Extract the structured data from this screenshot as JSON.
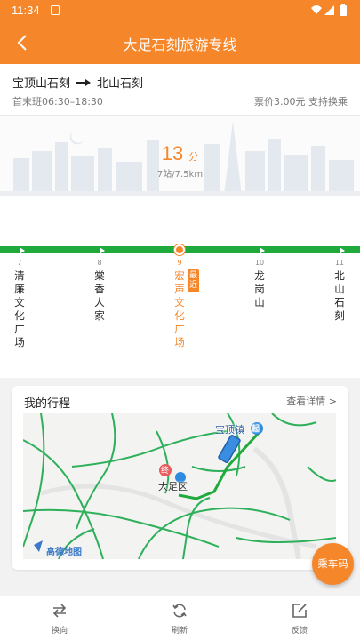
{
  "status": {
    "time": "11:34"
  },
  "header": {
    "title": "大足石刻旅游专线"
  },
  "route": {
    "from": "宝顶山石刻",
    "to": "北山石刻",
    "schedule": "首末班06:30–18:30",
    "fare": "票价3.00元 支持换乘"
  },
  "eta": {
    "value": "13",
    "unit": "分",
    "distance": "7站/7.5km"
  },
  "stations": [
    {
      "index": "7",
      "name": "清廉文化广场"
    },
    {
      "index": "8",
      "name": "棠香人家"
    },
    {
      "index": "9",
      "name": "宏声文化广场",
      "current": true,
      "badge": "最近"
    },
    {
      "index": "10",
      "name": "龙岗山"
    },
    {
      "index": "11",
      "name": "北山石刻"
    }
  ],
  "trip": {
    "title": "我的行程",
    "detail_link": "查看详情 >",
    "map": {
      "start_marker": "起",
      "end_marker": "终",
      "label_start": "宝顶镇",
      "label_district": "大足区",
      "provider": "高德地图"
    }
  },
  "ride_button": "乘车码",
  "bottom_tabs": [
    {
      "label": "换向",
      "icon": "swap-icon"
    },
    {
      "label": "刷新",
      "icon": "refresh-icon"
    },
    {
      "label": "反馈",
      "icon": "feedback-icon"
    }
  ],
  "colors": {
    "accent": "#f5862a",
    "line": "#1faa3b"
  }
}
